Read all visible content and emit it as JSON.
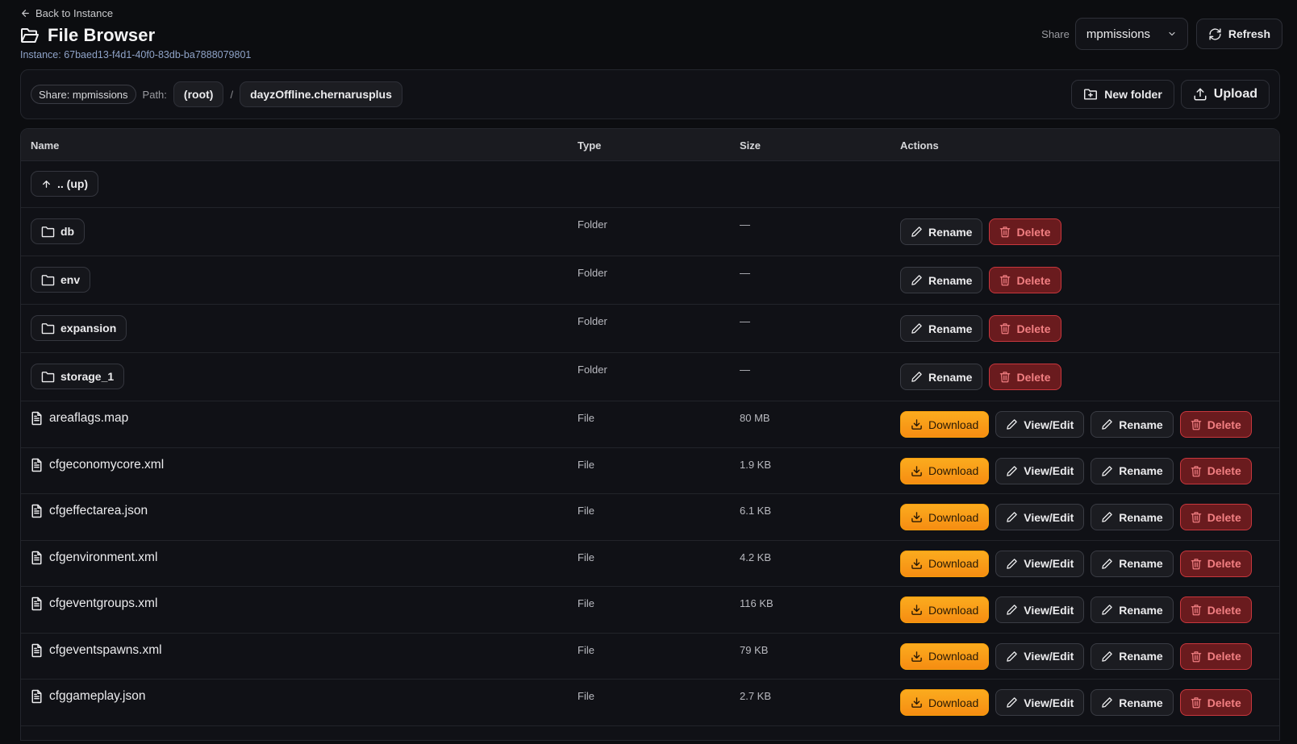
{
  "header": {
    "back_label": "Back to Instance",
    "title": "File Browser",
    "instance_line": "Instance: 67baed13-f4d1-40f0-83db-ba7888079801",
    "share_label": "Share",
    "share_selected": "mpmissions",
    "refresh_label": "Refresh"
  },
  "pathbar": {
    "share_chip": "Share: mpmissions",
    "path_label": "Path:",
    "crumbs": [
      "(root)",
      "dayzOffline.chernarusplus"
    ],
    "separator": "/",
    "new_folder_label": "New folder",
    "upload_label": "Upload"
  },
  "table": {
    "columns": [
      "Name",
      "Type",
      "Size",
      "Actions"
    ],
    "up_label": ".. (up)",
    "folders": [
      {
        "name": "db",
        "type": "Folder",
        "size": "—"
      },
      {
        "name": "env",
        "type": "Folder",
        "size": "—"
      },
      {
        "name": "expansion",
        "type": "Folder",
        "size": "—"
      },
      {
        "name": "storage_1",
        "type": "Folder",
        "size": "—"
      }
    ],
    "files": [
      {
        "name": "areaflags.map",
        "type": "File",
        "size": "80 MB"
      },
      {
        "name": "cfgeconomycore.xml",
        "type": "File",
        "size": "1.9 KB"
      },
      {
        "name": "cfgeffectarea.json",
        "type": "File",
        "size": "6.1 KB"
      },
      {
        "name": "cfgenvironment.xml",
        "type": "File",
        "size": "4.2 KB"
      },
      {
        "name": "cfgeventgroups.xml",
        "type": "File",
        "size": "116 KB"
      },
      {
        "name": "cfgeventspawns.xml",
        "type": "File",
        "size": "79 KB"
      },
      {
        "name": "cfggameplay.json",
        "type": "File",
        "size": "2.7 KB"
      }
    ],
    "actions": {
      "download": "Download",
      "view_edit": "View/Edit",
      "rename": "Rename",
      "delete": "Delete"
    }
  },
  "colors": {
    "background": "#0c0d10",
    "download_accent": "#f59e0b",
    "danger": "#c8373d",
    "instance_text": "#8fa3c8"
  }
}
